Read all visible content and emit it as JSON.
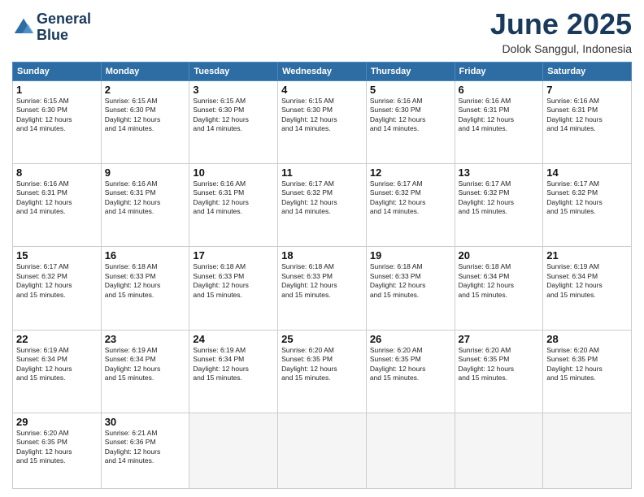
{
  "header": {
    "logo_line1": "General",
    "logo_line2": "Blue",
    "month": "June 2025",
    "location": "Dolok Sanggul, Indonesia"
  },
  "weekdays": [
    "Sunday",
    "Monday",
    "Tuesday",
    "Wednesday",
    "Thursday",
    "Friday",
    "Saturday"
  ],
  "weeks": [
    [
      {
        "day": "1",
        "info": "Sunrise: 6:15 AM\nSunset: 6:30 PM\nDaylight: 12 hours\nand 14 minutes."
      },
      {
        "day": "2",
        "info": "Sunrise: 6:15 AM\nSunset: 6:30 PM\nDaylight: 12 hours\nand 14 minutes."
      },
      {
        "day": "3",
        "info": "Sunrise: 6:15 AM\nSunset: 6:30 PM\nDaylight: 12 hours\nand 14 minutes."
      },
      {
        "day": "4",
        "info": "Sunrise: 6:15 AM\nSunset: 6:30 PM\nDaylight: 12 hours\nand 14 minutes."
      },
      {
        "day": "5",
        "info": "Sunrise: 6:16 AM\nSunset: 6:30 PM\nDaylight: 12 hours\nand 14 minutes."
      },
      {
        "day": "6",
        "info": "Sunrise: 6:16 AM\nSunset: 6:31 PM\nDaylight: 12 hours\nand 14 minutes."
      },
      {
        "day": "7",
        "info": "Sunrise: 6:16 AM\nSunset: 6:31 PM\nDaylight: 12 hours\nand 14 minutes."
      }
    ],
    [
      {
        "day": "8",
        "info": "Sunrise: 6:16 AM\nSunset: 6:31 PM\nDaylight: 12 hours\nand 14 minutes."
      },
      {
        "day": "9",
        "info": "Sunrise: 6:16 AM\nSunset: 6:31 PM\nDaylight: 12 hours\nand 14 minutes."
      },
      {
        "day": "10",
        "info": "Sunrise: 6:16 AM\nSunset: 6:31 PM\nDaylight: 12 hours\nand 14 minutes."
      },
      {
        "day": "11",
        "info": "Sunrise: 6:17 AM\nSunset: 6:32 PM\nDaylight: 12 hours\nand 14 minutes."
      },
      {
        "day": "12",
        "info": "Sunrise: 6:17 AM\nSunset: 6:32 PM\nDaylight: 12 hours\nand 14 minutes."
      },
      {
        "day": "13",
        "info": "Sunrise: 6:17 AM\nSunset: 6:32 PM\nDaylight: 12 hours\nand 15 minutes."
      },
      {
        "day": "14",
        "info": "Sunrise: 6:17 AM\nSunset: 6:32 PM\nDaylight: 12 hours\nand 15 minutes."
      }
    ],
    [
      {
        "day": "15",
        "info": "Sunrise: 6:17 AM\nSunset: 6:32 PM\nDaylight: 12 hours\nand 15 minutes."
      },
      {
        "day": "16",
        "info": "Sunrise: 6:18 AM\nSunset: 6:33 PM\nDaylight: 12 hours\nand 15 minutes."
      },
      {
        "day": "17",
        "info": "Sunrise: 6:18 AM\nSunset: 6:33 PM\nDaylight: 12 hours\nand 15 minutes."
      },
      {
        "day": "18",
        "info": "Sunrise: 6:18 AM\nSunset: 6:33 PM\nDaylight: 12 hours\nand 15 minutes."
      },
      {
        "day": "19",
        "info": "Sunrise: 6:18 AM\nSunset: 6:33 PM\nDaylight: 12 hours\nand 15 minutes."
      },
      {
        "day": "20",
        "info": "Sunrise: 6:18 AM\nSunset: 6:34 PM\nDaylight: 12 hours\nand 15 minutes."
      },
      {
        "day": "21",
        "info": "Sunrise: 6:19 AM\nSunset: 6:34 PM\nDaylight: 12 hours\nand 15 minutes."
      }
    ],
    [
      {
        "day": "22",
        "info": "Sunrise: 6:19 AM\nSunset: 6:34 PM\nDaylight: 12 hours\nand 15 minutes."
      },
      {
        "day": "23",
        "info": "Sunrise: 6:19 AM\nSunset: 6:34 PM\nDaylight: 12 hours\nand 15 minutes."
      },
      {
        "day": "24",
        "info": "Sunrise: 6:19 AM\nSunset: 6:34 PM\nDaylight: 12 hours\nand 15 minutes."
      },
      {
        "day": "25",
        "info": "Sunrise: 6:20 AM\nSunset: 6:35 PM\nDaylight: 12 hours\nand 15 minutes."
      },
      {
        "day": "26",
        "info": "Sunrise: 6:20 AM\nSunset: 6:35 PM\nDaylight: 12 hours\nand 15 minutes."
      },
      {
        "day": "27",
        "info": "Sunrise: 6:20 AM\nSunset: 6:35 PM\nDaylight: 12 hours\nand 15 minutes."
      },
      {
        "day": "28",
        "info": "Sunrise: 6:20 AM\nSunset: 6:35 PM\nDaylight: 12 hours\nand 15 minutes."
      }
    ],
    [
      {
        "day": "29",
        "info": "Sunrise: 6:20 AM\nSunset: 6:35 PM\nDaylight: 12 hours\nand 15 minutes."
      },
      {
        "day": "30",
        "info": "Sunrise: 6:21 AM\nSunset: 6:36 PM\nDaylight: 12 hours\nand 14 minutes."
      },
      {
        "day": "",
        "info": ""
      },
      {
        "day": "",
        "info": ""
      },
      {
        "day": "",
        "info": ""
      },
      {
        "day": "",
        "info": ""
      },
      {
        "day": "",
        "info": ""
      }
    ]
  ]
}
